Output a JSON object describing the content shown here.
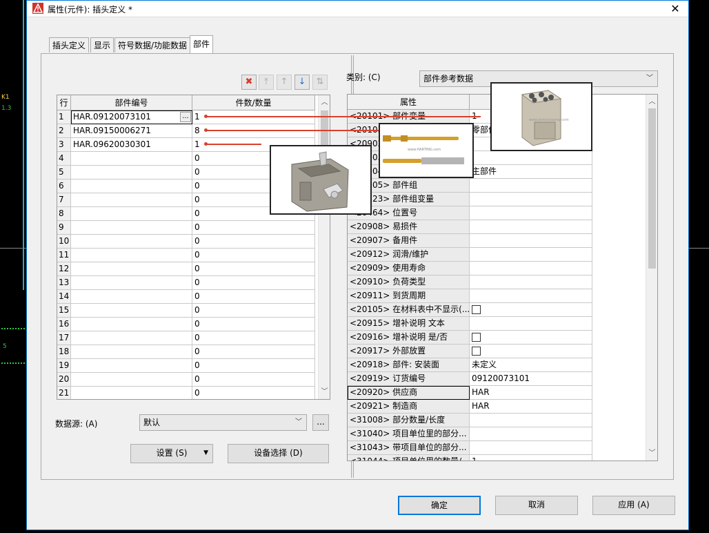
{
  "window": {
    "title": "属性(元件): 插头定义 *"
  },
  "tabs": [
    {
      "label": "插头定义"
    },
    {
      "label": "显示"
    },
    {
      "label": "符号数据/功能数据"
    },
    {
      "label": "部件"
    }
  ],
  "cad": {
    "label_k1": "K1",
    "label_13": "1.3",
    "label_5": "5"
  },
  "left_grid": {
    "headers": {
      "row": "行",
      "part_number": "部件编号",
      "quantity": "件数/数量"
    },
    "rows": [
      {
        "n": "1",
        "part": "HAR.09120073101",
        "qty": "1"
      },
      {
        "n": "2",
        "part": "HAR.09150006271",
        "qty": "8"
      },
      {
        "n": "3",
        "part": "HAR.09620030301",
        "qty": "1"
      },
      {
        "n": "4",
        "part": "",
        "qty": "0"
      },
      {
        "n": "5",
        "part": "",
        "qty": "0"
      },
      {
        "n": "6",
        "part": "",
        "qty": "0"
      },
      {
        "n": "7",
        "part": "",
        "qty": "0"
      },
      {
        "n": "8",
        "part": "",
        "qty": "0"
      },
      {
        "n": "9",
        "part": "",
        "qty": "0"
      },
      {
        "n": "10",
        "part": "",
        "qty": "0"
      },
      {
        "n": "11",
        "part": "",
        "qty": "0"
      },
      {
        "n": "12",
        "part": "",
        "qty": "0"
      },
      {
        "n": "13",
        "part": "",
        "qty": "0"
      },
      {
        "n": "14",
        "part": "",
        "qty": "0"
      },
      {
        "n": "15",
        "part": "",
        "qty": "0"
      },
      {
        "n": "16",
        "part": "",
        "qty": "0"
      },
      {
        "n": "17",
        "part": "",
        "qty": "0"
      },
      {
        "n": "18",
        "part": "",
        "qty": "0"
      },
      {
        "n": "19",
        "part": "",
        "qty": "0"
      },
      {
        "n": "20",
        "part": "",
        "qty": "0"
      },
      {
        "n": "21",
        "part": "",
        "qty": "0"
      }
    ],
    "ellipsis": "..."
  },
  "toolbar": {
    "delete_icon": "✖",
    "top_icon": "⤒",
    "up_icon": "↑",
    "down_icon": "↓",
    "sort_icon": "⇅"
  },
  "datasource": {
    "label": "数据源: (A)",
    "value": "默认",
    "more": "..."
  },
  "buttons": {
    "settings": "设置 (S)",
    "device_select": "设备选择 (D)",
    "ok": "确定",
    "cancel": "取消",
    "apply": "应用 (A)"
  },
  "category": {
    "label": "类别: (C)",
    "value": "部件参考数据"
  },
  "right_grid": {
    "headers": {
      "property": "属性",
      "value": "数值"
    },
    "rows": [
      {
        "prop": "<20101> 部件变量",
        "val": "1",
        "chk": false
      },
      {
        "prop": "<20103",
        "val": "零部件",
        "chk": false
      },
      {
        "prop": "<20902",
        "val": "",
        "chk": false
      },
      {
        "prop": "<20903",
        "val": "",
        "chk": false
      },
      {
        "prop": "<20904",
        "val": "主部件",
        "chk": false
      },
      {
        "prop": "<20105> 部件组",
        "val": "",
        "chk": false
      },
      {
        "prop": "<20123> 部件组变量",
        "val": "",
        "chk": false
      },
      {
        "prop": "<20464> 位置号",
        "val": "",
        "chk": false
      },
      {
        "prop": "<20908> 易损件",
        "val": "",
        "chk": false
      },
      {
        "prop": "<20907> 备用件",
        "val": "",
        "chk": false
      },
      {
        "prop": "<20912> 润滑/维护",
        "val": "",
        "chk": false
      },
      {
        "prop": "<20909> 使用寿命",
        "val": "",
        "chk": false
      },
      {
        "prop": "<20910> 负荷类型",
        "val": "",
        "chk": false
      },
      {
        "prop": "<20911> 到货周期",
        "val": "",
        "chk": false
      },
      {
        "prop": "<20105> 在材料表中不显示(...",
        "val": "",
        "chk": true
      },
      {
        "prop": "<20915> 增补说明 文本",
        "val": "",
        "chk": false
      },
      {
        "prop": "<20916> 增补说明 是/否",
        "val": "",
        "chk": true
      },
      {
        "prop": "<20917> 外部放置",
        "val": "",
        "chk": true
      },
      {
        "prop": "<20918> 部件: 安装面",
        "val": "未定义",
        "chk": false
      },
      {
        "prop": "<20919> 订货编号",
        "val": "09120073101",
        "chk": false
      },
      {
        "prop": "<20920> 供应商",
        "val": "HAR",
        "chk": false
      },
      {
        "prop": "<20921> 制造商",
        "val": "HAR",
        "chk": false
      },
      {
        "prop": "<31008> 部分数量/长度",
        "val": "",
        "chk": false
      },
      {
        "prop": "<31040> 项目单位里的部分...",
        "val": "",
        "chk": false
      },
      {
        "prop": "<31043> 带项目单位的部分...",
        "val": "",
        "chk": false
      },
      {
        "prop": "<31044> 项目单位里的数量/...",
        "val": "1",
        "chk": false
      }
    ]
  },
  "photos": {
    "pin_caption": "www.HARTING.com",
    "watermark": "www.jiandanwang.com"
  }
}
